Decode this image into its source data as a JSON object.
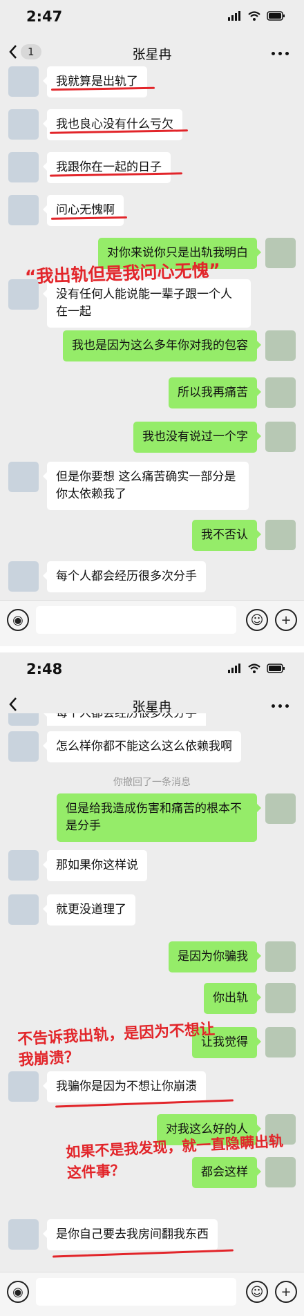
{
  "screen1": {
    "time": "2:47",
    "back_badge": "1",
    "title": "张星冉",
    "messages": [
      {
        "side": "l",
        "text": "我就算是出轨了"
      },
      {
        "side": "l",
        "text": "我也良心没有什么亏欠"
      },
      {
        "side": "l",
        "text": "我跟你在一起的日子"
      },
      {
        "side": "l",
        "text": "问心无愧啊"
      },
      {
        "side": "r",
        "text": "对你来说你只是出轨我明白"
      },
      {
        "side": "l",
        "text": "没有任何人能说能一辈子跟一个人在一起"
      },
      {
        "side": "r",
        "text": "我也是因为这么多年你对我的包容"
      },
      {
        "side": "r",
        "text": "所以我再痛苦"
      },
      {
        "side": "r",
        "text": "我也没有说过一个字"
      },
      {
        "side": "l",
        "text": "但是你要想 这么痛苦确实一部分是你太依赖我了"
      },
      {
        "side": "r",
        "text": "我不否认"
      },
      {
        "side": "l",
        "text": "每个人都会经历很多次分手"
      }
    ],
    "annotation": "“我出轨但是我问心无愧”"
  },
  "screen2": {
    "time": "2:48",
    "title": "张星冉",
    "partial_top": "每个人都会经历很多次分手",
    "messages": [
      {
        "side": "l",
        "text": "怎么样你都不能这么这么依赖我啊"
      },
      {
        "side": "r",
        "text": "但是给我造成伤害和痛苦的根本不是分手"
      },
      {
        "side": "l",
        "text": "那如果你这样说"
      },
      {
        "side": "l",
        "text": "就更没道理了"
      },
      {
        "side": "r",
        "text": "是因为你骗我"
      },
      {
        "side": "r",
        "text": "你出轨"
      },
      {
        "side": "r",
        "text": "让我觉得"
      },
      {
        "side": "l",
        "text": "我骗你是因为不想让你崩溃"
      },
      {
        "side": "r",
        "text": "对我这么好的人"
      },
      {
        "side": "r",
        "text": "都会这样"
      },
      {
        "side": "l",
        "text": "是你自己要去我房间翻我东西"
      }
    ],
    "system_note": "你撤回了一条消息",
    "annotation1": "不告诉我出轨，是因为不想让我崩溃？",
    "annotation2": "如果不是我发现，就一直隐瞒出轨这件事？"
  },
  "icons": [
    "signal-icon",
    "wifi-icon",
    "battery-icon",
    "back-icon",
    "more-icon",
    "voice-icon",
    "emoji-icon",
    "plus-icon"
  ],
  "colors": {
    "chat_bg": "#ededed",
    "sent_bubble": "#95ec69",
    "received_bubble": "#ffffff",
    "annotation": "#e2252a"
  }
}
